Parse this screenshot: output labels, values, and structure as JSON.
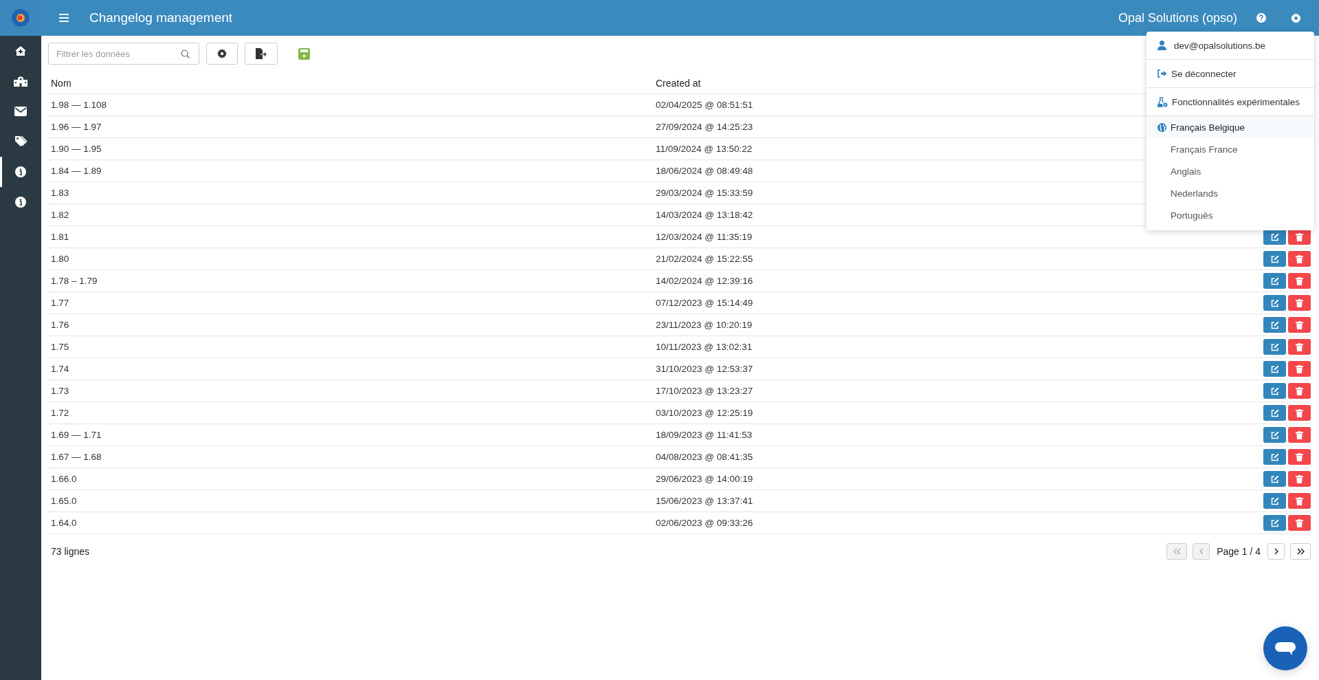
{
  "header": {
    "title": "Changelog management",
    "organization": "Opal Solutions (opso)"
  },
  "sidebar": {
    "items": [
      {
        "kind": "home",
        "selected": false
      },
      {
        "kind": "building",
        "selected": false
      },
      {
        "kind": "mail",
        "selected": false
      },
      {
        "kind": "tags",
        "selected": false
      },
      {
        "kind": "info",
        "selected": true
      },
      {
        "kind": "info",
        "selected": false
      }
    ]
  },
  "toolbar": {
    "search": {
      "placeholder": "Filtrer les données"
    }
  },
  "table": {
    "columns": [
      "Nom",
      "Created at"
    ],
    "rows": [
      [
        "1.98 — 1.108",
        "02/04/2025 @ 08:51:51"
      ],
      [
        "1.96 — 1.97",
        "27/09/2024 @ 14:25:23"
      ],
      [
        "1.90 — 1.95",
        "11/09/2024 @ 13:50:22"
      ],
      [
        "1.84 — 1.89",
        "18/06/2024 @ 08:49:48"
      ],
      [
        "1.83",
        "29/03/2024 @ 15:33:59"
      ],
      [
        "1.82",
        "14/03/2024 @ 13:18:42"
      ],
      [
        "1.81",
        "12/03/2024 @ 11:35:19"
      ],
      [
        "1.80",
        "21/02/2024 @ 15:22:55"
      ],
      [
        "1.78 – 1.79",
        "14/02/2024 @ 12:39:16"
      ],
      [
        "1.77",
        "07/12/2023 @ 15:14:49"
      ],
      [
        "1.76",
        "23/11/2023 @ 10:20:19"
      ],
      [
        "1.75",
        "10/11/2023 @ 13:02:31"
      ],
      [
        "1.74",
        "31/10/2023 @ 12:53:37"
      ],
      [
        "1.73",
        "17/10/2023 @ 13:23:27"
      ],
      [
        "1.72",
        "03/10/2023 @ 12:25:19"
      ],
      [
        "1.69 — 1.71",
        "18/09/2023 @ 11:41:53"
      ],
      [
        "1.67 — 1.68",
        "04/08/2023 @ 08:41:35"
      ],
      [
        "1.66.0",
        "29/06/2023 @ 14:00:19"
      ],
      [
        "1.65.0",
        "15/06/2023 @ 13:37:41"
      ],
      [
        "1.64.0",
        "02/06/2023 @ 09:33:26"
      ]
    ]
  },
  "footer": {
    "row_count": "73 lignes",
    "pagination": {
      "label": "Page 1 / 4",
      "first_disabled": true,
      "prev_disabled": true,
      "next_disabled": false,
      "last_disabled": false
    }
  },
  "user_menu": {
    "email": "dev@opalsolutions.be",
    "logout": "Se déconnecter",
    "experimental": "Fonctionnalités expérimentales",
    "languages": [
      {
        "label": "Français Belgique",
        "selected": true
      },
      {
        "label": "Français France",
        "selected": false
      },
      {
        "label": "Anglais",
        "selected": false
      },
      {
        "label": "Nederlands",
        "selected": false
      },
      {
        "label": "Português",
        "selected": false
      }
    ]
  }
}
